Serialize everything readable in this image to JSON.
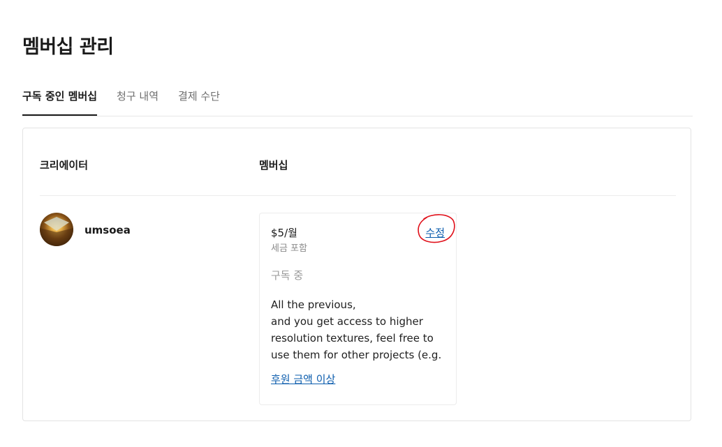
{
  "page": {
    "title": "멤버십 관리"
  },
  "tabs": [
    {
      "label": "구독 중인 멤버십",
      "active": true
    },
    {
      "label": "청구 내역",
      "active": false
    },
    {
      "label": "결제 수단",
      "active": false
    }
  ],
  "table": {
    "headers": {
      "creator": "크리에이터",
      "membership": "멤버십"
    },
    "rows": [
      {
        "creator_name": "umsoea",
        "tier": {
          "price": "$5/월",
          "edit_label": "수정",
          "tax_note": "세금 포함",
          "status": "구독 중",
          "description_lines": [
            "All the previous,",
            "and you get access to higher",
            "resolution textures, feel free to",
            "use them for other projects (e.g."
          ],
          "upgrade_label": "후원 금액 이상"
        }
      }
    ]
  },
  "colors": {
    "link": "#0b5cad",
    "annotation_ring": "#e0101a"
  }
}
